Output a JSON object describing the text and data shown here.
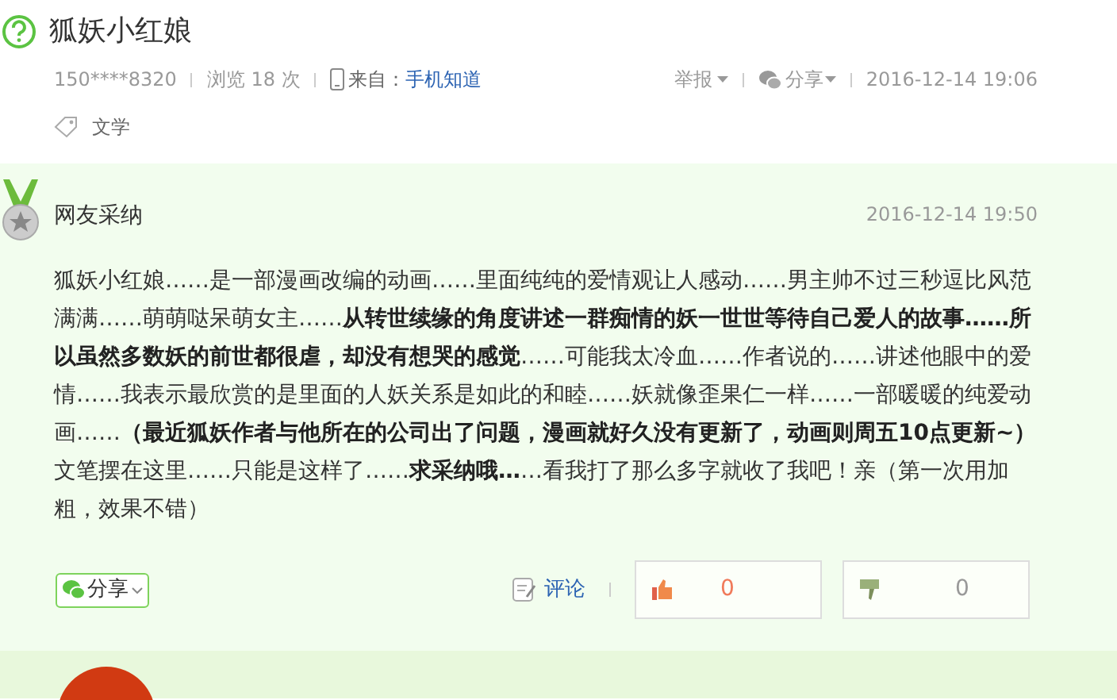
{
  "question": {
    "title": "狐妖小红娘",
    "user": "150****8320",
    "views": "浏览 18 次",
    "source_label": "来自：",
    "source_link": "手机知道",
    "report": "举报",
    "share": "分享",
    "time": "2016-12-14 19:06",
    "tags": [
      "文学"
    ]
  },
  "answer": {
    "badge": "网友采纳",
    "time": "2016-12-14 19:50",
    "body": "狐妖小红娘……是一部漫画改编的动画……里面纯纯的爱情观让人感动……男主帅不过三秒逗比风范满满……萌萌哒呆萌女主……**从转世续缘的角度讲述一群痴情的妖一世世等待自己爱人的故事……所以虽然多数妖的前世都很虐，却没有想哭的感觉**……可能我太冷血……作者说的……讲述他眼中的爱情……我表示最欣赏的是里面的人妖关系是如此的和睦……妖就像歪果仁一样……一部暖暖的纯爱动画……**（最近狐妖作者与他所在的公司出了问题，漫画就好久没有更新了，动画则周五10点更新~）**文笔摆在这里……只能是这样了……**求采纳哦…**…看我打了那么多字就收了我吧！亲（第一次用加粗，效果不错）",
    "share": "分享",
    "comment": "评论",
    "likes": "0",
    "dislikes": "0"
  }
}
